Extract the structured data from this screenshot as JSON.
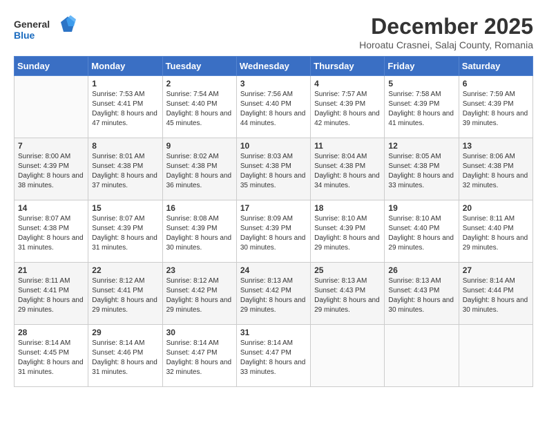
{
  "header": {
    "logo_general": "General",
    "logo_blue": "Blue",
    "title": "December 2025",
    "subtitle": "Horoatu Crasnei, Salaj County, Romania"
  },
  "days_of_week": [
    "Sunday",
    "Monday",
    "Tuesday",
    "Wednesday",
    "Thursday",
    "Friday",
    "Saturday"
  ],
  "weeks": [
    [
      {
        "day": "",
        "sunrise": "",
        "sunset": "",
        "daylight": ""
      },
      {
        "day": "1",
        "sunrise": "Sunrise: 7:53 AM",
        "sunset": "Sunset: 4:41 PM",
        "daylight": "Daylight: 8 hours and 47 minutes."
      },
      {
        "day": "2",
        "sunrise": "Sunrise: 7:54 AM",
        "sunset": "Sunset: 4:40 PM",
        "daylight": "Daylight: 8 hours and 45 minutes."
      },
      {
        "day": "3",
        "sunrise": "Sunrise: 7:56 AM",
        "sunset": "Sunset: 4:40 PM",
        "daylight": "Daylight: 8 hours and 44 minutes."
      },
      {
        "day": "4",
        "sunrise": "Sunrise: 7:57 AM",
        "sunset": "Sunset: 4:39 PM",
        "daylight": "Daylight: 8 hours and 42 minutes."
      },
      {
        "day": "5",
        "sunrise": "Sunrise: 7:58 AM",
        "sunset": "Sunset: 4:39 PM",
        "daylight": "Daylight: 8 hours and 41 minutes."
      },
      {
        "day": "6",
        "sunrise": "Sunrise: 7:59 AM",
        "sunset": "Sunset: 4:39 PM",
        "daylight": "Daylight: 8 hours and 39 minutes."
      }
    ],
    [
      {
        "day": "7",
        "sunrise": "Sunrise: 8:00 AM",
        "sunset": "Sunset: 4:39 PM",
        "daylight": "Daylight: 8 hours and 38 minutes."
      },
      {
        "day": "8",
        "sunrise": "Sunrise: 8:01 AM",
        "sunset": "Sunset: 4:38 PM",
        "daylight": "Daylight: 8 hours and 37 minutes."
      },
      {
        "day": "9",
        "sunrise": "Sunrise: 8:02 AM",
        "sunset": "Sunset: 4:38 PM",
        "daylight": "Daylight: 8 hours and 36 minutes."
      },
      {
        "day": "10",
        "sunrise": "Sunrise: 8:03 AM",
        "sunset": "Sunset: 4:38 PM",
        "daylight": "Daylight: 8 hours and 35 minutes."
      },
      {
        "day": "11",
        "sunrise": "Sunrise: 8:04 AM",
        "sunset": "Sunset: 4:38 PM",
        "daylight": "Daylight: 8 hours and 34 minutes."
      },
      {
        "day": "12",
        "sunrise": "Sunrise: 8:05 AM",
        "sunset": "Sunset: 4:38 PM",
        "daylight": "Daylight: 8 hours and 33 minutes."
      },
      {
        "day": "13",
        "sunrise": "Sunrise: 8:06 AM",
        "sunset": "Sunset: 4:38 PM",
        "daylight": "Daylight: 8 hours and 32 minutes."
      }
    ],
    [
      {
        "day": "14",
        "sunrise": "Sunrise: 8:07 AM",
        "sunset": "Sunset: 4:38 PM",
        "daylight": "Daylight: 8 hours and 31 minutes."
      },
      {
        "day": "15",
        "sunrise": "Sunrise: 8:07 AM",
        "sunset": "Sunset: 4:39 PM",
        "daylight": "Daylight: 8 hours and 31 minutes."
      },
      {
        "day": "16",
        "sunrise": "Sunrise: 8:08 AM",
        "sunset": "Sunset: 4:39 PM",
        "daylight": "Daylight: 8 hours and 30 minutes."
      },
      {
        "day": "17",
        "sunrise": "Sunrise: 8:09 AM",
        "sunset": "Sunset: 4:39 PM",
        "daylight": "Daylight: 8 hours and 30 minutes."
      },
      {
        "day": "18",
        "sunrise": "Sunrise: 8:10 AM",
        "sunset": "Sunset: 4:39 PM",
        "daylight": "Daylight: 8 hours and 29 minutes."
      },
      {
        "day": "19",
        "sunrise": "Sunrise: 8:10 AM",
        "sunset": "Sunset: 4:40 PM",
        "daylight": "Daylight: 8 hours and 29 minutes."
      },
      {
        "day": "20",
        "sunrise": "Sunrise: 8:11 AM",
        "sunset": "Sunset: 4:40 PM",
        "daylight": "Daylight: 8 hours and 29 minutes."
      }
    ],
    [
      {
        "day": "21",
        "sunrise": "Sunrise: 8:11 AM",
        "sunset": "Sunset: 4:41 PM",
        "daylight": "Daylight: 8 hours and 29 minutes."
      },
      {
        "day": "22",
        "sunrise": "Sunrise: 8:12 AM",
        "sunset": "Sunset: 4:41 PM",
        "daylight": "Daylight: 8 hours and 29 minutes."
      },
      {
        "day": "23",
        "sunrise": "Sunrise: 8:12 AM",
        "sunset": "Sunset: 4:42 PM",
        "daylight": "Daylight: 8 hours and 29 minutes."
      },
      {
        "day": "24",
        "sunrise": "Sunrise: 8:13 AM",
        "sunset": "Sunset: 4:42 PM",
        "daylight": "Daylight: 8 hours and 29 minutes."
      },
      {
        "day": "25",
        "sunrise": "Sunrise: 8:13 AM",
        "sunset": "Sunset: 4:43 PM",
        "daylight": "Daylight: 8 hours and 29 minutes."
      },
      {
        "day": "26",
        "sunrise": "Sunrise: 8:13 AM",
        "sunset": "Sunset: 4:43 PM",
        "daylight": "Daylight: 8 hours and 30 minutes."
      },
      {
        "day": "27",
        "sunrise": "Sunrise: 8:14 AM",
        "sunset": "Sunset: 4:44 PM",
        "daylight": "Daylight: 8 hours and 30 minutes."
      }
    ],
    [
      {
        "day": "28",
        "sunrise": "Sunrise: 8:14 AM",
        "sunset": "Sunset: 4:45 PM",
        "daylight": "Daylight: 8 hours and 31 minutes."
      },
      {
        "day": "29",
        "sunrise": "Sunrise: 8:14 AM",
        "sunset": "Sunset: 4:46 PM",
        "daylight": "Daylight: 8 hours and 31 minutes."
      },
      {
        "day": "30",
        "sunrise": "Sunrise: 8:14 AM",
        "sunset": "Sunset: 4:47 PM",
        "daylight": "Daylight: 8 hours and 32 minutes."
      },
      {
        "day": "31",
        "sunrise": "Sunrise: 8:14 AM",
        "sunset": "Sunset: 4:47 PM",
        "daylight": "Daylight: 8 hours and 33 minutes."
      },
      {
        "day": "",
        "sunrise": "",
        "sunset": "",
        "daylight": ""
      },
      {
        "day": "",
        "sunrise": "",
        "sunset": "",
        "daylight": ""
      },
      {
        "day": "",
        "sunrise": "",
        "sunset": "",
        "daylight": ""
      }
    ]
  ]
}
